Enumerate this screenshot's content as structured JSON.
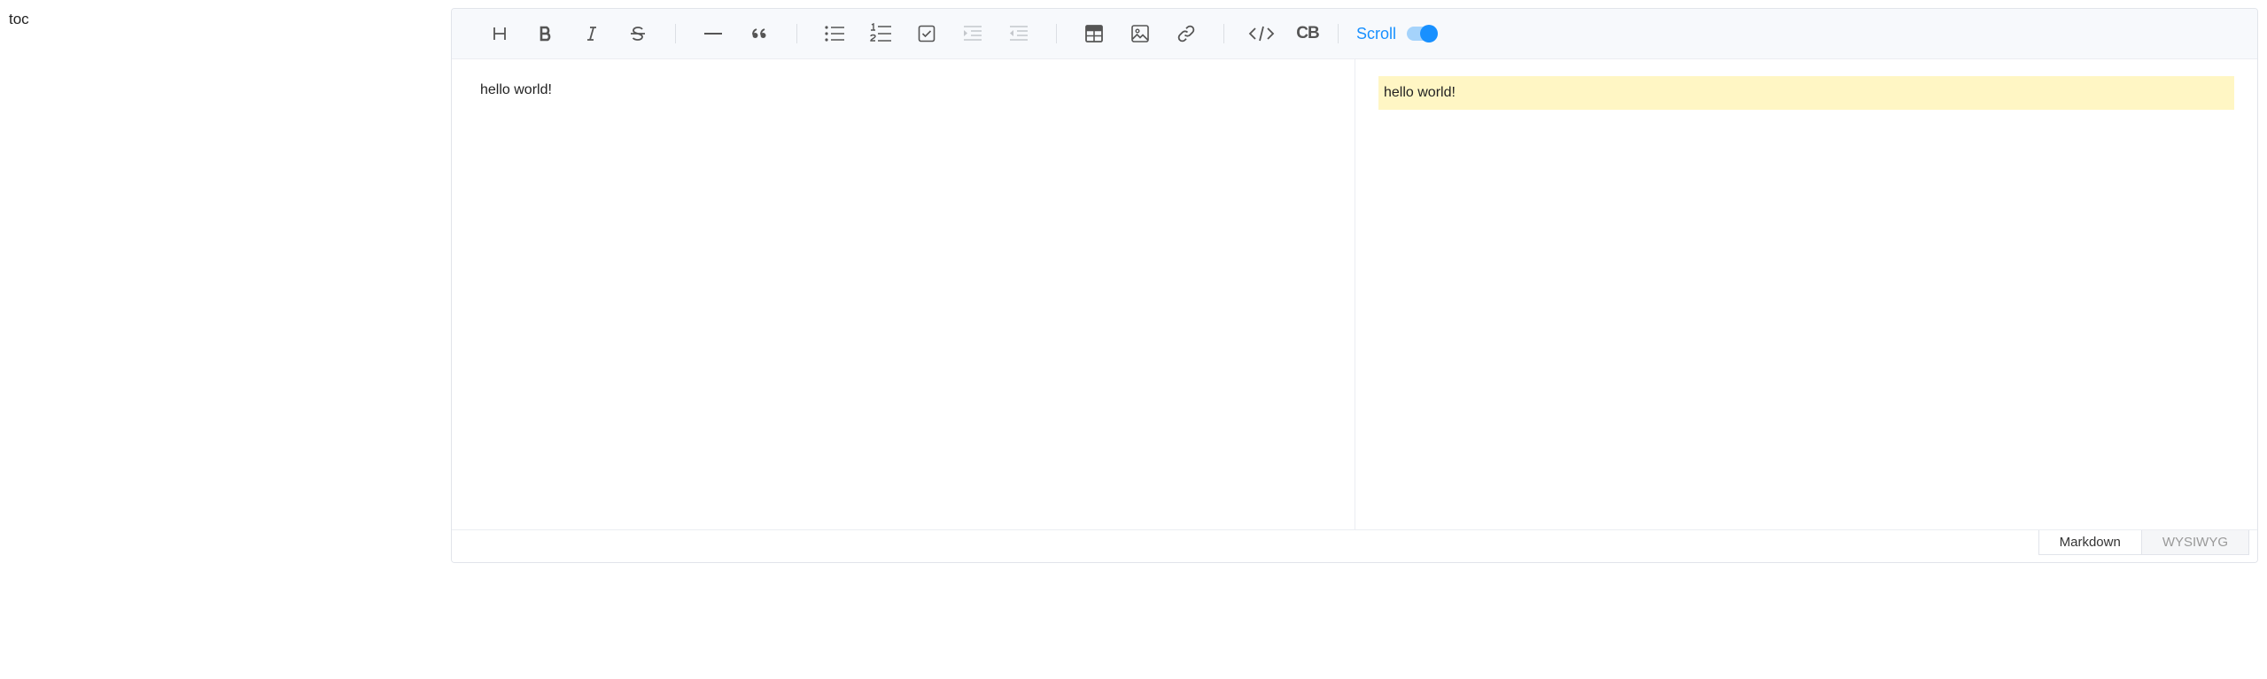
{
  "toc": {
    "label": "toc"
  },
  "toolbar": {
    "buttons": [
      {
        "icon": "heading-icon",
        "disabled": false
      },
      {
        "icon": "bold-icon",
        "disabled": false
      },
      {
        "icon": "italic-icon",
        "disabled": false
      },
      {
        "icon": "strike-icon",
        "disabled": false
      },
      {
        "icon": "horizontal-rule-icon",
        "disabled": false
      },
      {
        "icon": "quote-icon",
        "disabled": false
      },
      {
        "icon": "bullet-list-icon",
        "disabled": false
      },
      {
        "icon": "ordered-list-icon",
        "disabled": false
      },
      {
        "icon": "task-icon",
        "disabled": false
      },
      {
        "icon": "indent-icon",
        "disabled": true
      },
      {
        "icon": "outdent-icon",
        "disabled": true
      },
      {
        "icon": "table-icon",
        "disabled": false
      },
      {
        "icon": "image-icon",
        "disabled": false
      },
      {
        "icon": "link-icon",
        "disabled": false
      },
      {
        "icon": "code-icon",
        "disabled": false
      },
      {
        "icon": "codeblock-icon",
        "disabled": false
      }
    ],
    "codeblock_text": "CB",
    "scroll_label": "Scroll",
    "scroll_sync_on": true,
    "accent_color": "#1890ff"
  },
  "editor": {
    "markdown_text": "hello world!",
    "preview_text": "hello world!",
    "highlight_color": "#fff6c4"
  },
  "footer": {
    "markdown_tab": "Markdown",
    "wysiwyg_tab": "WYSIWYG",
    "active_mode": "Markdown"
  }
}
